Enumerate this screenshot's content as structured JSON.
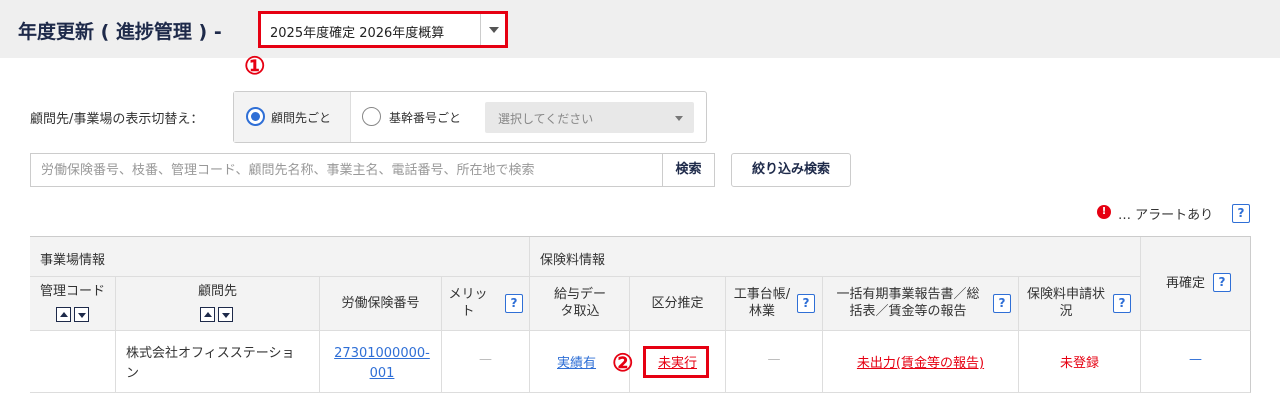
{
  "header": {
    "title": "年度更新 ( 進捗管理 ) -",
    "year_select": "2025年度確定 2026年度概算"
  },
  "markers": {
    "m1": "①",
    "m2": "②"
  },
  "display_switch": {
    "label": "顧問先/事業場の表示切替え：",
    "option1": "顧問先ごと",
    "option2": "基幹番号ごと",
    "select_placeholder": "選択してください"
  },
  "search": {
    "placeholder": "労働保険番号、枝番、管理コード、顧問先名称、事業主名、電話番号、所在地で検索",
    "button": "検索",
    "filter_button": "絞り込み検索"
  },
  "alert_legend": {
    "icon": "!",
    "text": "… アラートあり",
    "help": "?"
  },
  "table": {
    "groups": {
      "site": "事業場情報",
      "premium": "保険料情報",
      "reconfirm": "再確定"
    },
    "columns": {
      "code": "管理コード",
      "client": "顧問先",
      "insurance_no": "労働保険番号",
      "merit": "メリット",
      "salary": "給与データ取込",
      "category": "区分推定",
      "ledger": "工事台帳/林業",
      "report": "一括有期事業報告書／総括表／賃金等の報告",
      "application": "保険料申請状況"
    },
    "row": {
      "code": "",
      "client": "株式会社オフィスステーション",
      "insurance_no": "27301000000-001",
      "merit": "—",
      "salary": "実績有",
      "category": "未実行",
      "ledger": "—",
      "report": "未出力(賃金等の報告)",
      "application": "未登録",
      "reconfirm": "—"
    }
  },
  "colors": {
    "accent": "#e60012",
    "link": "#2f6fd6",
    "title": "#1e2a4a"
  }
}
